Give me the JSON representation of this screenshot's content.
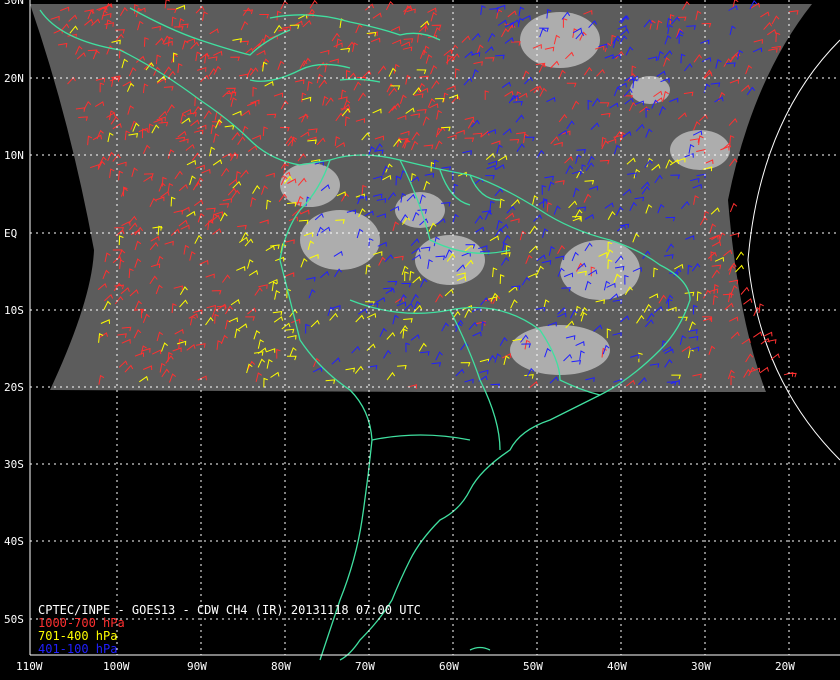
{
  "title": "CPTEC/INPE - GOES13 - CDW CH4 (IR) 20131118 07:00 UTC",
  "legend": [
    {
      "label": "1000-700 hPa",
      "color": "#ff3030"
    },
    {
      "label": "701-400 hPa",
      "color": "#ffff00"
    },
    {
      "label": "401-100 hPa",
      "color": "#2020ff"
    }
  ],
  "lat_labels": [
    "30N",
    "20N",
    "10N",
    "EQ",
    "10S",
    "20S",
    "30S",
    "40S",
    "50S"
  ],
  "lon_labels": [
    "110W",
    "100W",
    "90W",
    "80W",
    "70W",
    "60W",
    "50W",
    "40W",
    "30W",
    "20W"
  ],
  "colors": {
    "background": "#000000",
    "coastline": "#40e0a0",
    "grid": "#ffffff",
    "imagery": "#5a5a5a"
  }
}
